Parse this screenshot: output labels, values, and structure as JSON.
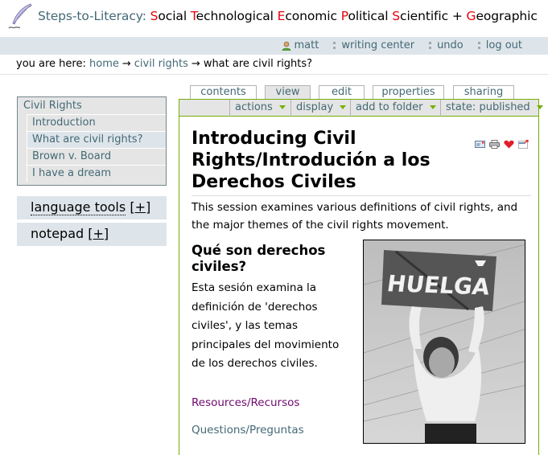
{
  "header": {
    "logo_icon": "quill-pen-icon",
    "brand": "Steps-to-Literacy:",
    "subtitle_words": [
      {
        "cap": "S",
        "rest": "ocial"
      },
      {
        "cap": "T",
        "rest": "echnological"
      },
      {
        "cap": "E",
        "rest": "conomic"
      },
      {
        "cap": "P",
        "rest": "olitical"
      },
      {
        "cap": "S",
        "rest": "cientific +"
      },
      {
        "cap": "G",
        "rest": "eographic"
      }
    ],
    "colors": {
      "brand": "#436976",
      "cap": "#e3040d"
    }
  },
  "personal_bar": {
    "user": "matt",
    "user_icon": "user-icon",
    "items": [
      "writing center",
      "undo",
      "log out"
    ]
  },
  "breadcrumb": {
    "prefix": "you are here:",
    "arrow": "→",
    "links": [
      "home",
      "civil rights"
    ],
    "current": "what are civil rights?"
  },
  "sidebar": {
    "nav_title": "Civil Rights",
    "nav_items": [
      {
        "label": "Introduction",
        "current": false
      },
      {
        "label": "What are civil rights?",
        "current": true
      },
      {
        "label": "Brown v. Board",
        "current": false
      },
      {
        "label": "I have a dream",
        "current": false
      }
    ],
    "portlets": [
      {
        "label": "language tools",
        "toggle": "+"
      },
      {
        "label": "notepad",
        "toggle": "+"
      }
    ]
  },
  "tabs": [
    {
      "label": "contents",
      "active": false
    },
    {
      "label": "view",
      "active": true
    },
    {
      "label": "edit",
      "active": false
    },
    {
      "label": "properties",
      "active": false
    },
    {
      "label": "sharing",
      "active": false
    }
  ],
  "action_menus": {
    "actions": "actions",
    "display": "display",
    "add_to_folder": "add to folder",
    "state_label": "state:",
    "state_value": "published"
  },
  "document": {
    "title": "Introducing Civil Rights/Introdución a los Derechos Civiles",
    "action_icons": [
      "send-mail-icon",
      "print-icon",
      "favorite-heart-icon",
      "full-screen-icon"
    ],
    "description": "This session examines various definitions of civil rights, and the major themes of the civil rights movement.",
    "subheading": "Qué son derechos civiles?",
    "body": "Esta sesión examina la definición de 'derechos civiles', y las temas principales del movimiento de los derechos civiles.",
    "links": {
      "resources": "Resources/Recursos",
      "questions": "Questions/Preguntas"
    },
    "image": {
      "alt": "Woman holding HUELGA sign",
      "sign_text": "HUELGA"
    }
  },
  "colors": {
    "link": "#436976",
    "visited_link": "#6f0a6e",
    "green_border": "#74ae0b",
    "bar_bg": "#dee5ea",
    "menu_bg": "#e5e5e5"
  }
}
